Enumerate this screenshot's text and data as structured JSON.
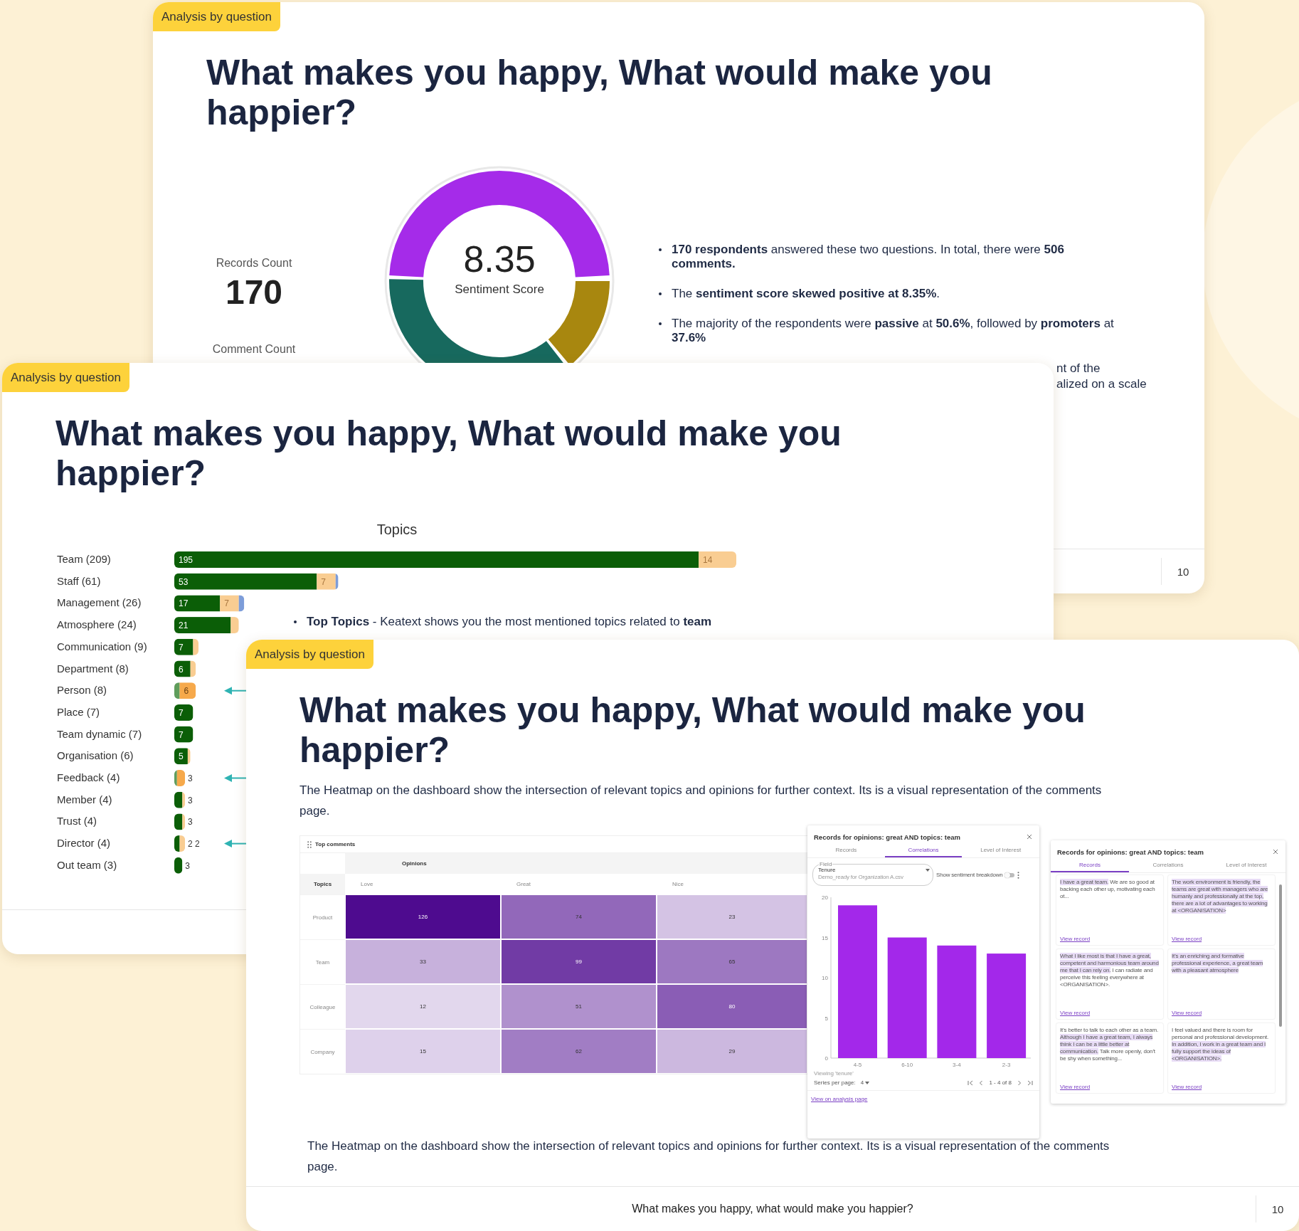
{
  "slides": [
    {
      "kind": "summary",
      "tag": "Analysis by question",
      "title": "What makes you happy, What would make you happier?",
      "records_count": {
        "label": "Records Count",
        "value": "170"
      },
      "comment_count": {
        "label": "Comment Count"
      },
      "sentiment": {
        "value": "8.35",
        "label": "Sentiment Score"
      },
      "bullets": [
        "**170 respondents** answered these two questions. In total, there were **506 comments.**",
        "The **sentiment score skewed positive at 8.35%**.",
        "The majority of the respondents were **passive** at **50.6%**, followed by **promoters** at **37.6%**"
      ],
      "cut_text": [
        "nt of the",
        "alized on a scale"
      ],
      "footer": {
        "page_number": "10"
      }
    },
    {
      "kind": "topics",
      "tag": "Analysis by question",
      "title": "What makes you happy, What would make you happier?",
      "chart_data": {
        "type": "bar",
        "title": "Topics",
        "orientation": "horizontal",
        "stacked": true,
        "categories": [
          "Team (209)",
          "Staff (61)",
          "Management (26)",
          "Atmosphere (24)",
          "Communication (9)",
          "Department (8)",
          "Person (8)",
          "Place (7)",
          "Team dynamic (7)",
          "Organisation (6)",
          "Feedback (4)",
          "Member (4)",
          "Trust (4)",
          "Director (4)",
          "Out team (3)"
        ],
        "series": [
          {
            "color": "#0b5e07",
            "values": [
              195,
              53,
              17,
              21,
              7,
              6,
              0,
              7,
              7,
              5,
              0,
              3,
              3,
              2,
              3
            ],
            "value_labels": [
              "195",
              "53",
              "17",
              "21",
              "7",
              "6",
              null,
              "7",
              "7",
              "5",
              null,
              "3",
              "3",
              "2",
              "3"
            ]
          },
          {
            "color": "#5f9d5c",
            "values": [
              0,
              0,
              0,
              0,
              0,
              0,
              2,
              0,
              0,
              0,
              1,
              0,
              0,
              0,
              0
            ]
          },
          {
            "color": "#f9cd92",
            "values": [
              14,
              7,
              7,
              3,
              2,
              2,
              0,
              0,
              0,
              1,
              0,
              1,
              1,
              2,
              0
            ],
            "value_labels": [
              "14",
              "7",
              "7",
              null,
              null,
              null,
              null,
              null,
              null,
              null,
              null,
              null,
              null,
              "2",
              null
            ]
          },
          {
            "color": "#f6a94b",
            "values": [
              0,
              0,
              0,
              0,
              0,
              0,
              6,
              0,
              0,
              0,
              3,
              0,
              0,
              0,
              0
            ],
            "value_labels": [
              null,
              null,
              null,
              null,
              null,
              null,
              "6",
              null,
              null,
              null,
              "3",
              null,
              null,
              null,
              null
            ]
          },
          {
            "color": "#7d9dd9",
            "values": [
              0,
              1,
              2,
              0,
              0,
              0,
              0,
              0,
              0,
              0,
              0,
              0,
              0,
              0,
              0
            ]
          }
        ]
      },
      "row_arrows": [
        false,
        false,
        false,
        false,
        false,
        false,
        true,
        false,
        false,
        false,
        true,
        false,
        false,
        true,
        false
      ],
      "note": "**Top Topics** - Keatext shows you the most mentioned topics related to **team**"
    },
    {
      "kind": "heatmap",
      "tag": "Analysis by question",
      "title": "What makes you happy, What would make you happier?",
      "paragraphs": [
        "The Heatmap on the dashboard show the intersection of relevant topics and opinions for further context. Its is a visual representation of the comments page.",
        "The Heatmap on the dashboard show the intersection of relevant topics and opinions for further context. Its is a visual representation of the comments page."
      ],
      "heatmap": {
        "title": "Top comments",
        "column_group": "Opinions",
        "row_header": "Topics",
        "columns": [
          "Love",
          "Great",
          "Nice"
        ],
        "rows": [
          {
            "topic": "Product",
            "values": [
              "126",
              "74",
              "23"
            ]
          },
          {
            "topic": "Team",
            "values": [
              "33",
              "99",
              "65"
            ]
          },
          {
            "topic": "Colleague",
            "values": [
              "12",
              "51",
              "80"
            ]
          },
          {
            "topic": "Company",
            "values": [
              "15",
              "62",
              "29"
            ]
          }
        ]
      },
      "correlations_panel": {
        "title": "Records for opinions: great AND topics: team",
        "tabs": [
          {
            "label": "Records",
            "selected": false
          },
          {
            "label": "Correlations",
            "selected": true
          },
          {
            "label": "Level of Interest",
            "selected": false
          }
        ],
        "field": {
          "label": "Field",
          "value": "Tenure",
          "source": "Demo_ready for Organization A.csv"
        },
        "toggle": {
          "label": "Show sentiment breakdown",
          "on": false
        },
        "chart_data": {
          "type": "bar",
          "categories": [
            "4-5",
            "6-10",
            "3-4",
            "2-3"
          ],
          "series": [
            {
              "color": "#a328ea",
              "values": [
                19,
                15,
                14,
                13
              ]
            }
          ],
          "ylim": [
            0,
            20
          ],
          "yticks": [
            0,
            5,
            10,
            15,
            20
          ]
        },
        "viewing": "Viewing 'tenure'",
        "series_per_page": {
          "label": "Series per page:",
          "value": "4"
        },
        "pagination": "1 - 4 of 8",
        "link": "View on analysis page"
      },
      "records_panel": {
        "title": "Records for opinions: great AND topics: team",
        "tabs": [
          {
            "label": "Records",
            "selected": true
          },
          {
            "label": "Correlations",
            "selected": false
          },
          {
            "label": "Level of Interest",
            "selected": false
          }
        ],
        "records": [
          {
            "segments": [
              {
                "text": "I have a great team.",
                "highlighted": true
              },
              {
                "text": " We are so good at backing each other up, motivating each ot...",
                "highlighted": false
              }
            ],
            "link": "View record"
          },
          {
            "segments": [
              {
                "text": "The work environment is friendly, the teams are great with managers who are humanly and professionally at the top, there are a lot of advantages to working at <ORGANISATION>",
                "highlighted": true
              }
            ],
            "link": "View record"
          },
          {
            "segments": [
              {
                "text": "What I like most is that I have a great, competent and harmonious team around me that I can rely on.",
                "highlighted": true
              },
              {
                "text": " I can radiate and perceive this feeling everywhere at <ORGANISATION>.",
                "highlighted": false
              }
            ],
            "link": "View record"
          },
          {
            "segments": [
              {
                "text": "It's an enriching and formative professional experience, a great team with a pleasant atmosphere",
                "highlighted": true
              }
            ],
            "link": "View record"
          },
          {
            "segments": [
              {
                "text": "It's better to talk to each other as a team. ",
                "highlighted": false
              },
              {
                "text": "Although I have a great team, I always think I can be a little better at communication.",
                "highlighted": true
              },
              {
                "text": " Talk more openly, don't be shy when something...",
                "highlighted": false
              }
            ],
            "link": "View record"
          },
          {
            "segments": [
              {
                "text": "I feel valued and there is room for personal and professional development. ",
                "highlighted": false
              },
              {
                "text": "In addition, I work in a great team and I fully support the ideas of <ORGANISATION>.",
                "highlighted": true
              }
            ],
            "link": "View record"
          }
        ]
      },
      "footer": {
        "text": "What makes you happy, what would make you happier?",
        "page_number": "10"
      }
    }
  ]
}
